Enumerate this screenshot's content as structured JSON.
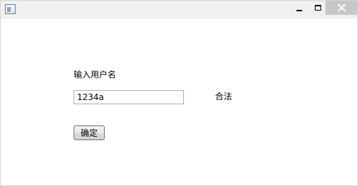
{
  "window": {
    "controls": {
      "minimize_icon": "minimize-icon",
      "maximize_icon": "maximize-icon",
      "close_icon": "close-icon"
    }
  },
  "form": {
    "prompt_label": "输入用户名",
    "username_value": "1234a",
    "status_text": "合法",
    "confirm_label": "确定"
  }
}
